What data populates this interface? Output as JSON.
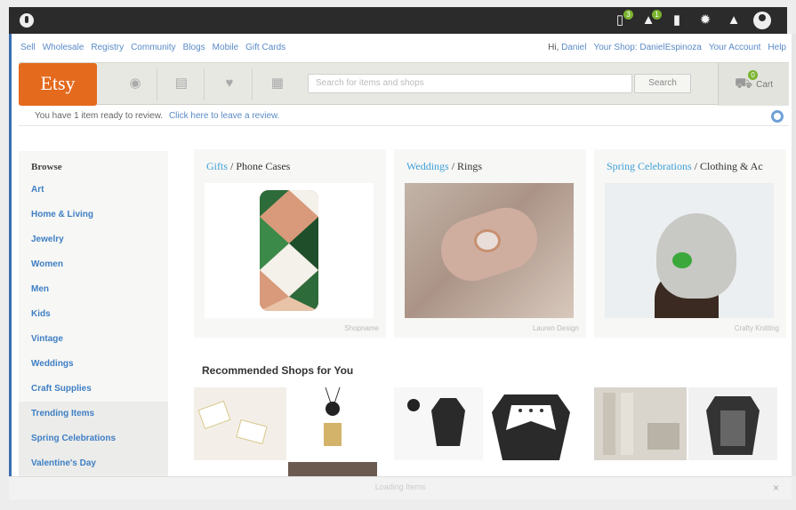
{
  "topbar": {
    "icons": [
      {
        "name": "shop-icon",
        "badge": "3"
      },
      {
        "name": "favorites-icon",
        "badge": "1"
      },
      {
        "name": "document-icon",
        "badge": ""
      },
      {
        "name": "gear-icon",
        "badge": ""
      },
      {
        "name": "bell-icon",
        "badge": ""
      }
    ]
  },
  "util_nav": {
    "left": [
      "Sell",
      "Wholesale",
      "Registry",
      "Community",
      "Blogs",
      "Mobile",
      "Gift Cards"
    ],
    "greeting": "Hi,",
    "username": "Daniel",
    "right": [
      "Your Shop: DanielEspinoza",
      "Your Account",
      "Help"
    ]
  },
  "header": {
    "logo": "Etsy",
    "search_placeholder": "Search for items and shops",
    "search_button": "Search",
    "cart_label": "Cart",
    "cart_badge": "0",
    "nav_icons": [
      "activity-icon",
      "messages-icon",
      "heart-icon",
      "shop-icon"
    ]
  },
  "notice": {
    "text": "You have 1 item ready to review.",
    "link": "Click here to leave a review."
  },
  "browse": {
    "title": "Browse",
    "items": [
      "Art",
      "Home & Living",
      "Jewelry",
      "Women",
      "Men",
      "Kids",
      "Vintage",
      "Weddings",
      "Craft Supplies",
      "Trending Items",
      "Spring Celebrations",
      "Valentine's Day"
    ]
  },
  "cards": [
    {
      "category": "Gifts",
      "sub": " / Phone Cases",
      "credit": "Shopname"
    },
    {
      "category": "Weddings",
      "sub": " / Rings",
      "credit": "Lauren Design"
    },
    {
      "category": "Spring Celebrations",
      "sub": " / Clothing & Ac",
      "credit": "Crafty Knitting"
    }
  ],
  "recommended": {
    "title": "Recommended Shops for You"
  },
  "bottombar": {
    "text": "Loading Items",
    "close": "×"
  },
  "colors": {
    "etsy_orange": "#e46a1e",
    "link_blue": "#3e7fc4",
    "badge_green": "#7ab32e"
  }
}
